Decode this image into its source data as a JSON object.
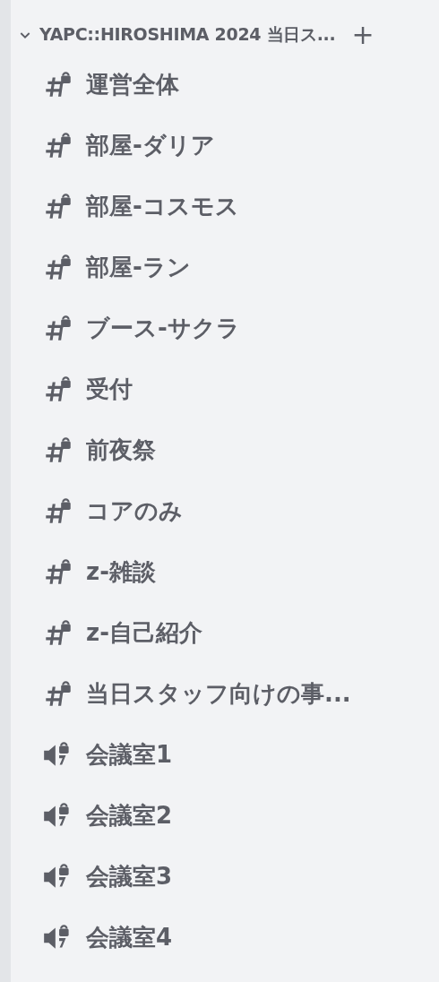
{
  "category": {
    "title": "YAPC::HIROSHIMA 2024 当日ス...",
    "expanded": true,
    "add_button": "+"
  },
  "channels": [
    {
      "kind": "text",
      "name": "運営全体"
    },
    {
      "kind": "text",
      "name": "部屋-ダリア"
    },
    {
      "kind": "text",
      "name": "部屋-コスモス"
    },
    {
      "kind": "text",
      "name": "部屋-ラン"
    },
    {
      "kind": "text",
      "name": "ブース-サクラ"
    },
    {
      "kind": "text",
      "name": "受付"
    },
    {
      "kind": "text",
      "name": "前夜祭"
    },
    {
      "kind": "text",
      "name": "コアのみ"
    },
    {
      "kind": "text",
      "name": "z-雑談"
    },
    {
      "kind": "text",
      "name": "z-自己紹介"
    },
    {
      "kind": "text",
      "name": "当日スタッフ向けの事..."
    },
    {
      "kind": "voice",
      "name": "会議室1"
    },
    {
      "kind": "voice",
      "name": "会議室2"
    },
    {
      "kind": "voice",
      "name": "会議室3"
    },
    {
      "kind": "voice",
      "name": "会議室4"
    }
  ]
}
